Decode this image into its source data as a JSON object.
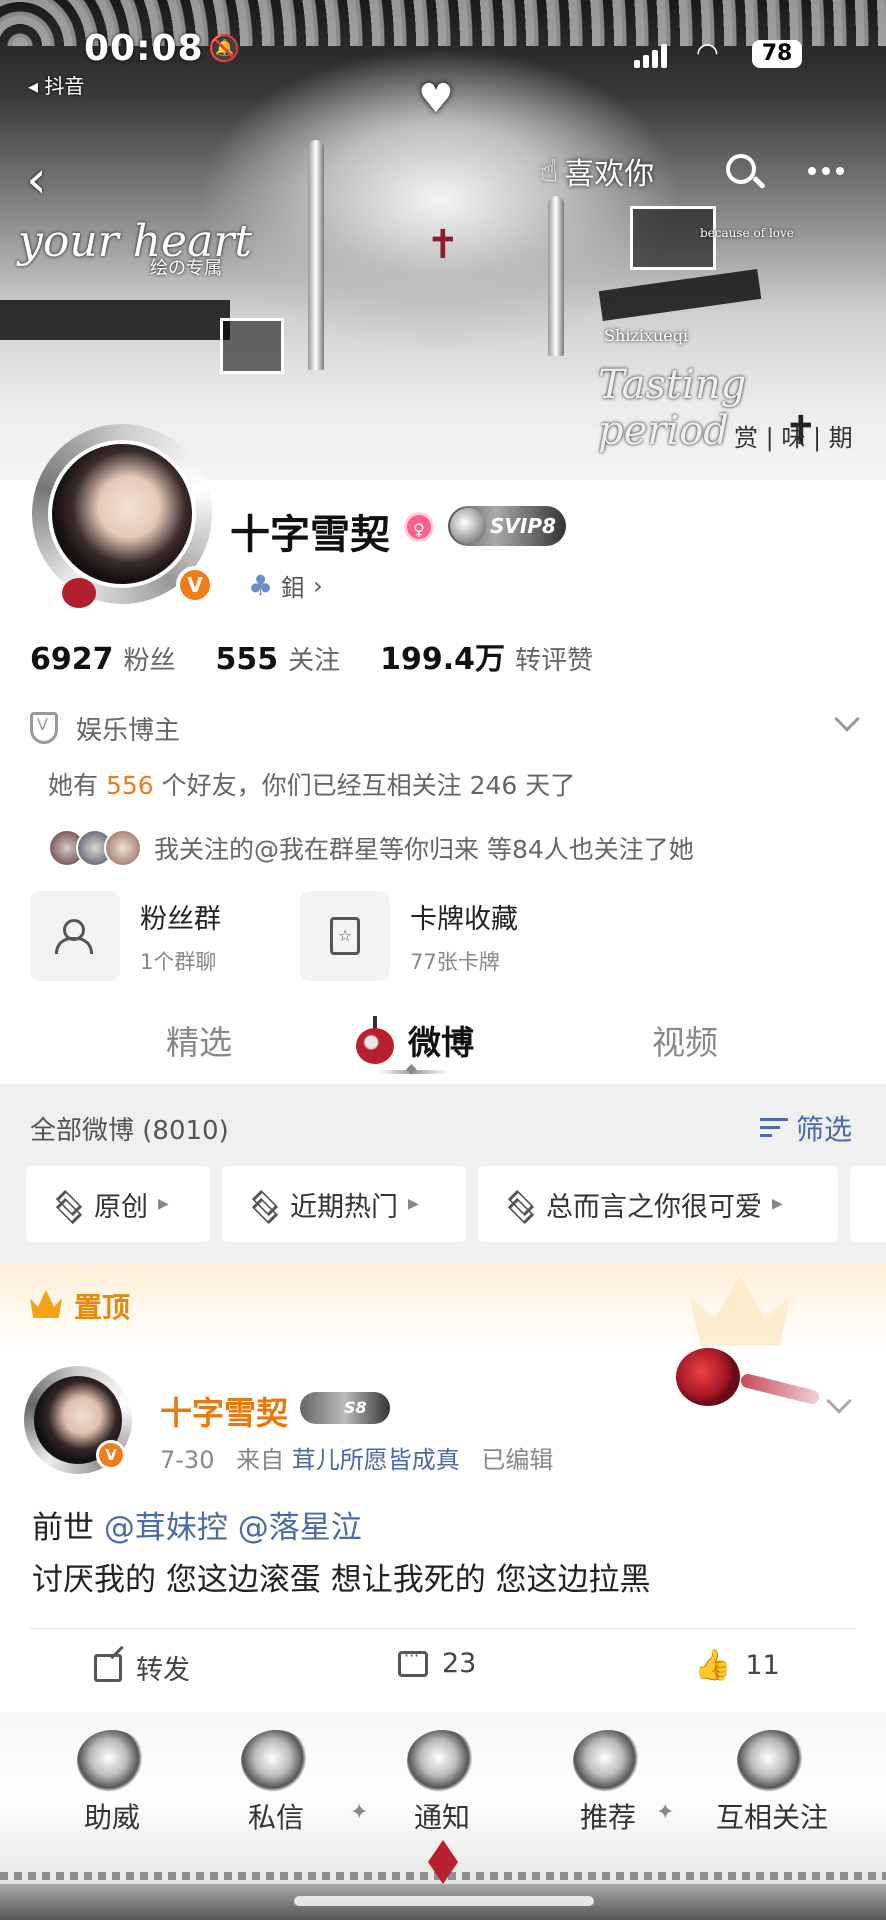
{
  "status_bar": {
    "time": "00:08",
    "back_app": "◂ 抖音",
    "battery": "78"
  },
  "banner": {
    "like_label": "喜欢你",
    "deco_text_1": "your heart",
    "deco_text_2": "绘の专属",
    "deco_text_3": "because of love",
    "deco_text_4": "Tasting period",
    "deco_text_5": "赏 | 味 | 期",
    "deco_text_6": "Shizixueqi"
  },
  "profile": {
    "name": "十字雪契",
    "svip": "SVIP8",
    "level": "鉬",
    "followers_count": "6927",
    "followers_label": "粉丝",
    "following_count": "555",
    "following_label": "关注",
    "likes_count": "199.4万",
    "likes_label": "转评赞",
    "category": "娱乐博主",
    "friends_prefix": "她有",
    "friends_count": "556",
    "friends_suffix": "个好友，你们已经互相关注 246 天了",
    "followed_by": "我关注的@我在群星等你归来 等84人也关注了她"
  },
  "cards": [
    {
      "title": "粉丝群",
      "sub": "1个群聊"
    },
    {
      "title": "卡牌收藏",
      "sub": "77张卡牌"
    }
  ],
  "tabs": [
    {
      "label": "精选"
    },
    {
      "label": "微博"
    },
    {
      "label": "视频"
    }
  ],
  "feed": {
    "count": "全部微博 (8010)",
    "filter": "筛选",
    "chips": [
      {
        "label": "原创"
      },
      {
        "label": "近期热门"
      },
      {
        "label": "总而言之你很可爱"
      }
    ]
  },
  "pinned": {
    "label": "置顶",
    "author": "十字雪契",
    "badge": "S8",
    "date": "7-30",
    "source_prefix": "来自",
    "source": "茸儿所愿皆成真",
    "edited": "已编辑",
    "body_prefix": "前世",
    "mention_1": "@茸妹控",
    "mention_2": "@落星泣",
    "body_line_2": "讨厌我的 您这边滚蛋 想让我死的 您这边拉黑",
    "share_label": "转发",
    "comments": "23",
    "likes": "11"
  },
  "bottom_nav": [
    {
      "label": "助威"
    },
    {
      "label": "私信"
    },
    {
      "label": "通知"
    },
    {
      "label": "推荐"
    },
    {
      "label": "互相关注"
    }
  ],
  "colors": {
    "accent_orange": "#f07c1a",
    "link_blue": "#4a6aa8",
    "pinned_gold": "#e8890d"
  }
}
